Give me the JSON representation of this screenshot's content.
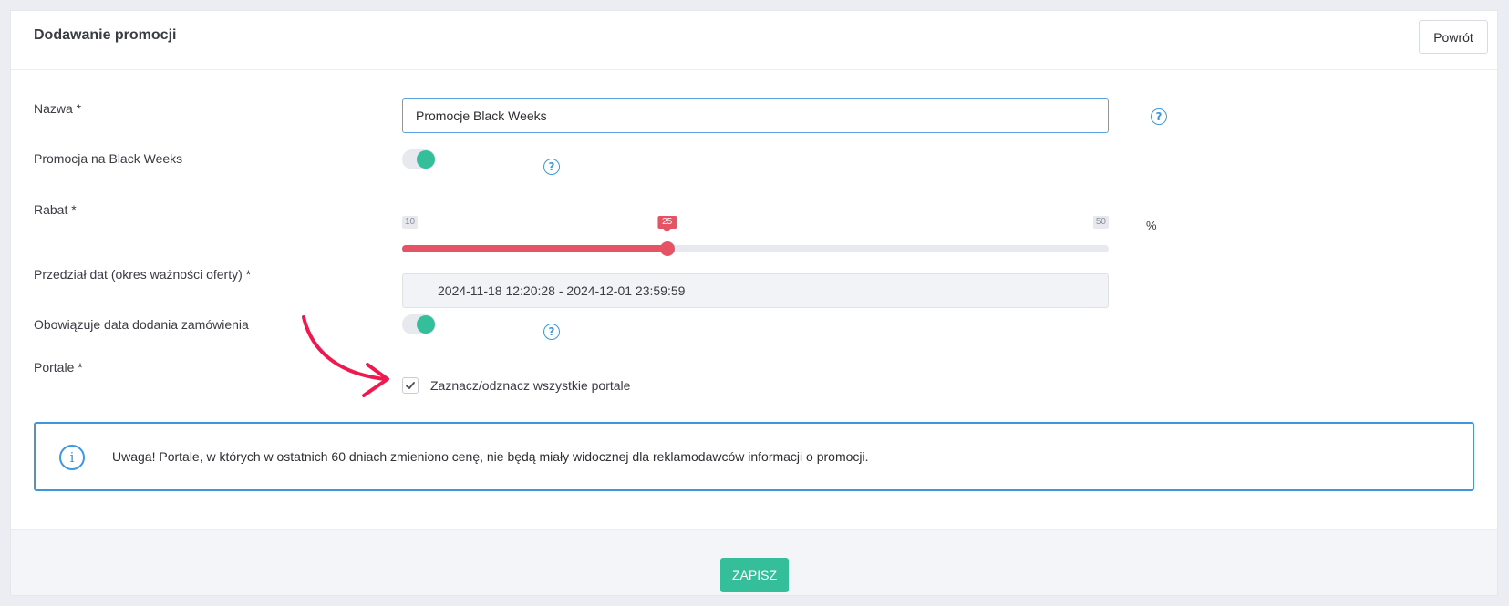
{
  "header": {
    "title": "Dodawanie promocji",
    "back_label": "Powrót"
  },
  "form": {
    "name": {
      "label": "Nazwa *",
      "value": "Promocje Black Weeks"
    },
    "black_weeks": {
      "label": "Promocja na Black Weeks",
      "enabled": true
    },
    "discount": {
      "label": "Rabat *",
      "min": "10",
      "max": "50",
      "value": "25",
      "unit": "%"
    },
    "date_range": {
      "label": "Przedział dat (okres ważności oferty) *",
      "value": "2024-11-18 12:20:28 - 2024-12-01 23:59:59"
    },
    "order_date": {
      "label": "Obowiązuje data dodania zamówienia",
      "enabled": true
    },
    "portals": {
      "label": "Portale *",
      "select_all_label": "Zaznacz/odznacz wszystkie portale",
      "checked": true
    }
  },
  "notice": {
    "text": "Uwaga! Portale, w których w ostatnich 60 dniach zmieniono cenę, nie będą miały widocznej dla reklamodawców informacji o promocji."
  },
  "footer": {
    "save_label": "ZAPISZ"
  },
  "colors": {
    "accent_green": "#34bf9a",
    "accent_red": "#e55365",
    "accent_blue": "#3d97de",
    "annotation_arrow": "#f0194f"
  },
  "icons": {
    "help": "question-circle-icon",
    "info": "info-circle-icon",
    "check": "check-icon",
    "arrow": "curved-arrow-icon"
  }
}
